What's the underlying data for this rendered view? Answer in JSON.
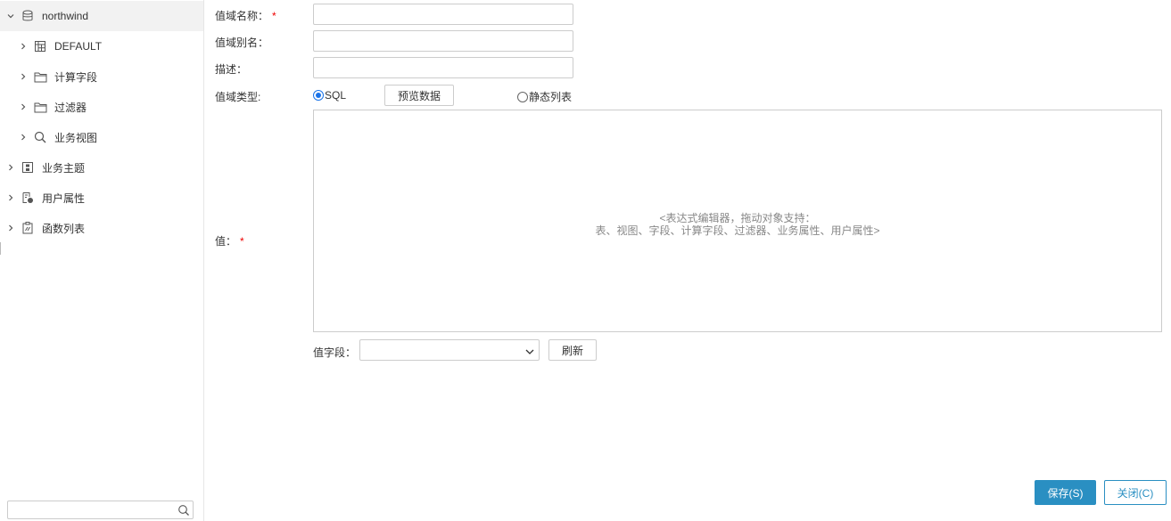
{
  "tree": {
    "root": {
      "label": "northwind",
      "icon": "database-icon"
    },
    "items": [
      {
        "label": "DEFAULT",
        "icon": "table-schema-icon"
      },
      {
        "label": "计算字段",
        "icon": "folder-icon"
      },
      {
        "label": "过滤器",
        "icon": "folder-icon"
      },
      {
        "label": "业务视图",
        "icon": "search-icon"
      },
      {
        "label": "业务主题",
        "icon": "business-theme-icon"
      },
      {
        "label": "用户属性",
        "icon": "user-attribute-icon"
      },
      {
        "label": "函数列表",
        "icon": "function-list-icon"
      }
    ],
    "search_placeholder": ""
  },
  "form": {
    "name_label": "值域名称：",
    "name_required": "*",
    "name_value": "",
    "alias_label": "值域别名：",
    "alias_value": "",
    "desc_label": "描述：",
    "desc_value": "",
    "type_label": "值域类型:",
    "type_option_sql": "SQL",
    "type_option_static": "静态列表",
    "type_selected": "SQL",
    "preview_button": "预览数据",
    "value_label": "值：",
    "value_required": "*",
    "editor_placeholder_line1": "<表达式编辑器，拖动对象支持：",
    "editor_placeholder_line2": "表、视图、字段、计算字段、过滤器、业务属性、用户属性>",
    "value_field_label": "值字段：",
    "value_field_selected": "",
    "refresh_button": "刷新"
  },
  "footer": {
    "save_button": "保存(S)",
    "close_button": "关闭(C)"
  },
  "colors": {
    "primary": "#2a8fc2",
    "required": "#ee0000",
    "selected_row": "#f2f2f2"
  }
}
